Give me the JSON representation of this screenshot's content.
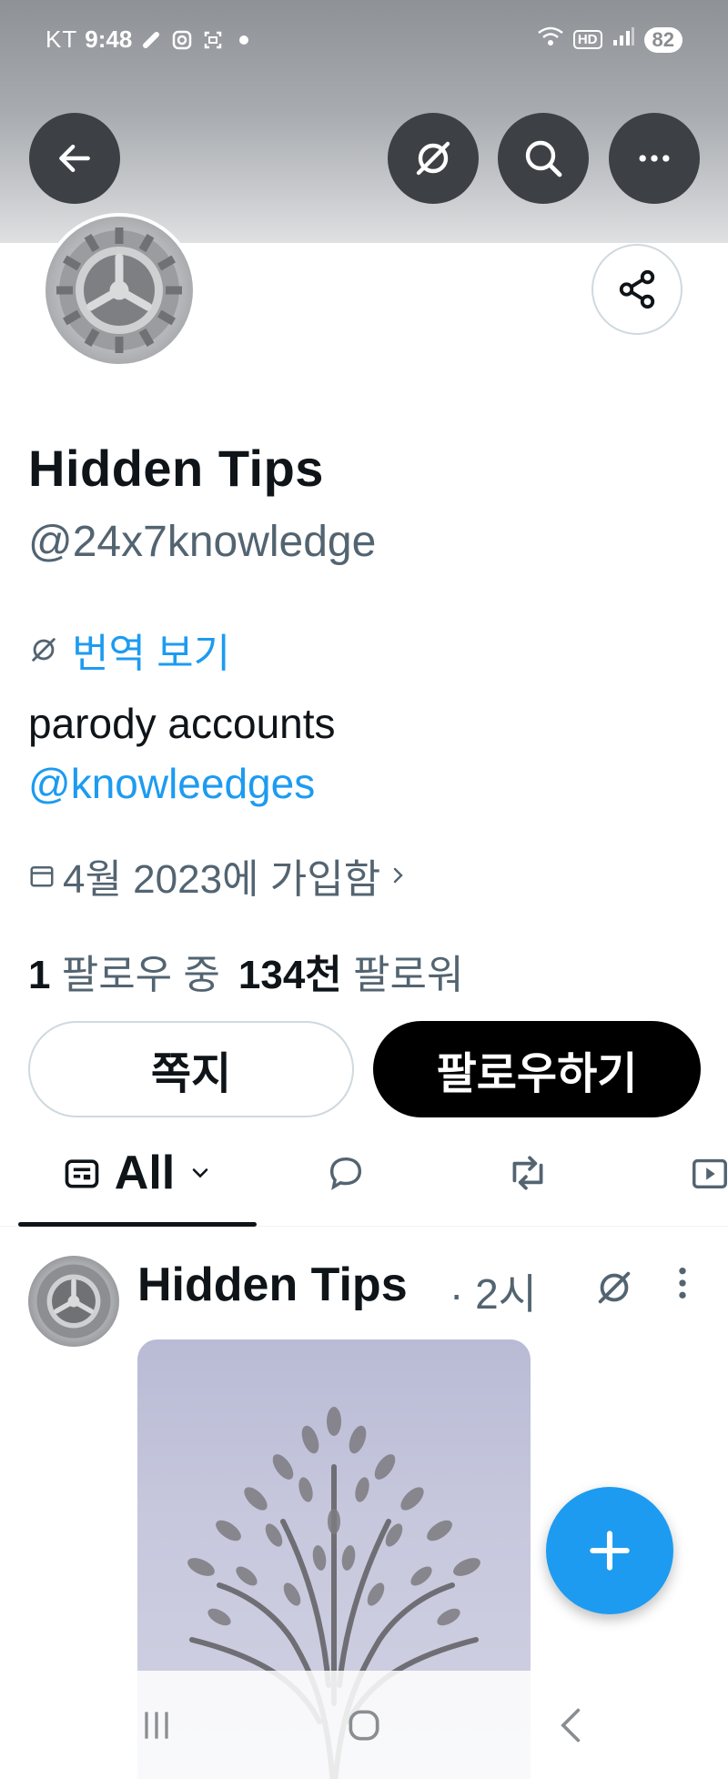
{
  "status_bar": {
    "carrier": "KT",
    "time": "9:48",
    "network": "HD",
    "battery": "82",
    "icons": [
      "link-icon",
      "instagram-icon",
      "screenshot-icon",
      "dot-icon",
      "wifi-icon",
      "hd-icon",
      "signal-icon"
    ]
  },
  "header": {
    "icons": [
      "back-arrow-icon",
      "translate-icon",
      "search-icon",
      "more-icon"
    ]
  },
  "profile": {
    "name": "Hidden Tips",
    "handle": "@24x7knowledge",
    "translate_link": "번역 보기",
    "bio_text": "parody accounts",
    "bio_mention": "@knowleedges",
    "joined": "4월 2023에 가입함",
    "following_count": "1",
    "following_label": "팔로우 중",
    "followers_count": "134천",
    "followers_label": "팔로워",
    "message_button": "쪽지",
    "follow_button": "팔로우하기"
  },
  "tabs": {
    "active_label": "All",
    "icons": [
      "posts-icon",
      "reply-icon",
      "repost-icon",
      "video-icon"
    ]
  },
  "post": {
    "author": "Hidden Tips",
    "time": "· 2시",
    "image_description_icon": "tree-illustration"
  },
  "fab": {
    "icon": "plus-icon"
  },
  "nav_bar": {
    "icons": [
      "recent-apps-icon",
      "home-icon",
      "back-icon"
    ]
  },
  "colors": {
    "accent": "#1d9bf0",
    "text_primary": "#0f1419",
    "text_secondary": "#536471",
    "button_dark": "#000000"
  }
}
